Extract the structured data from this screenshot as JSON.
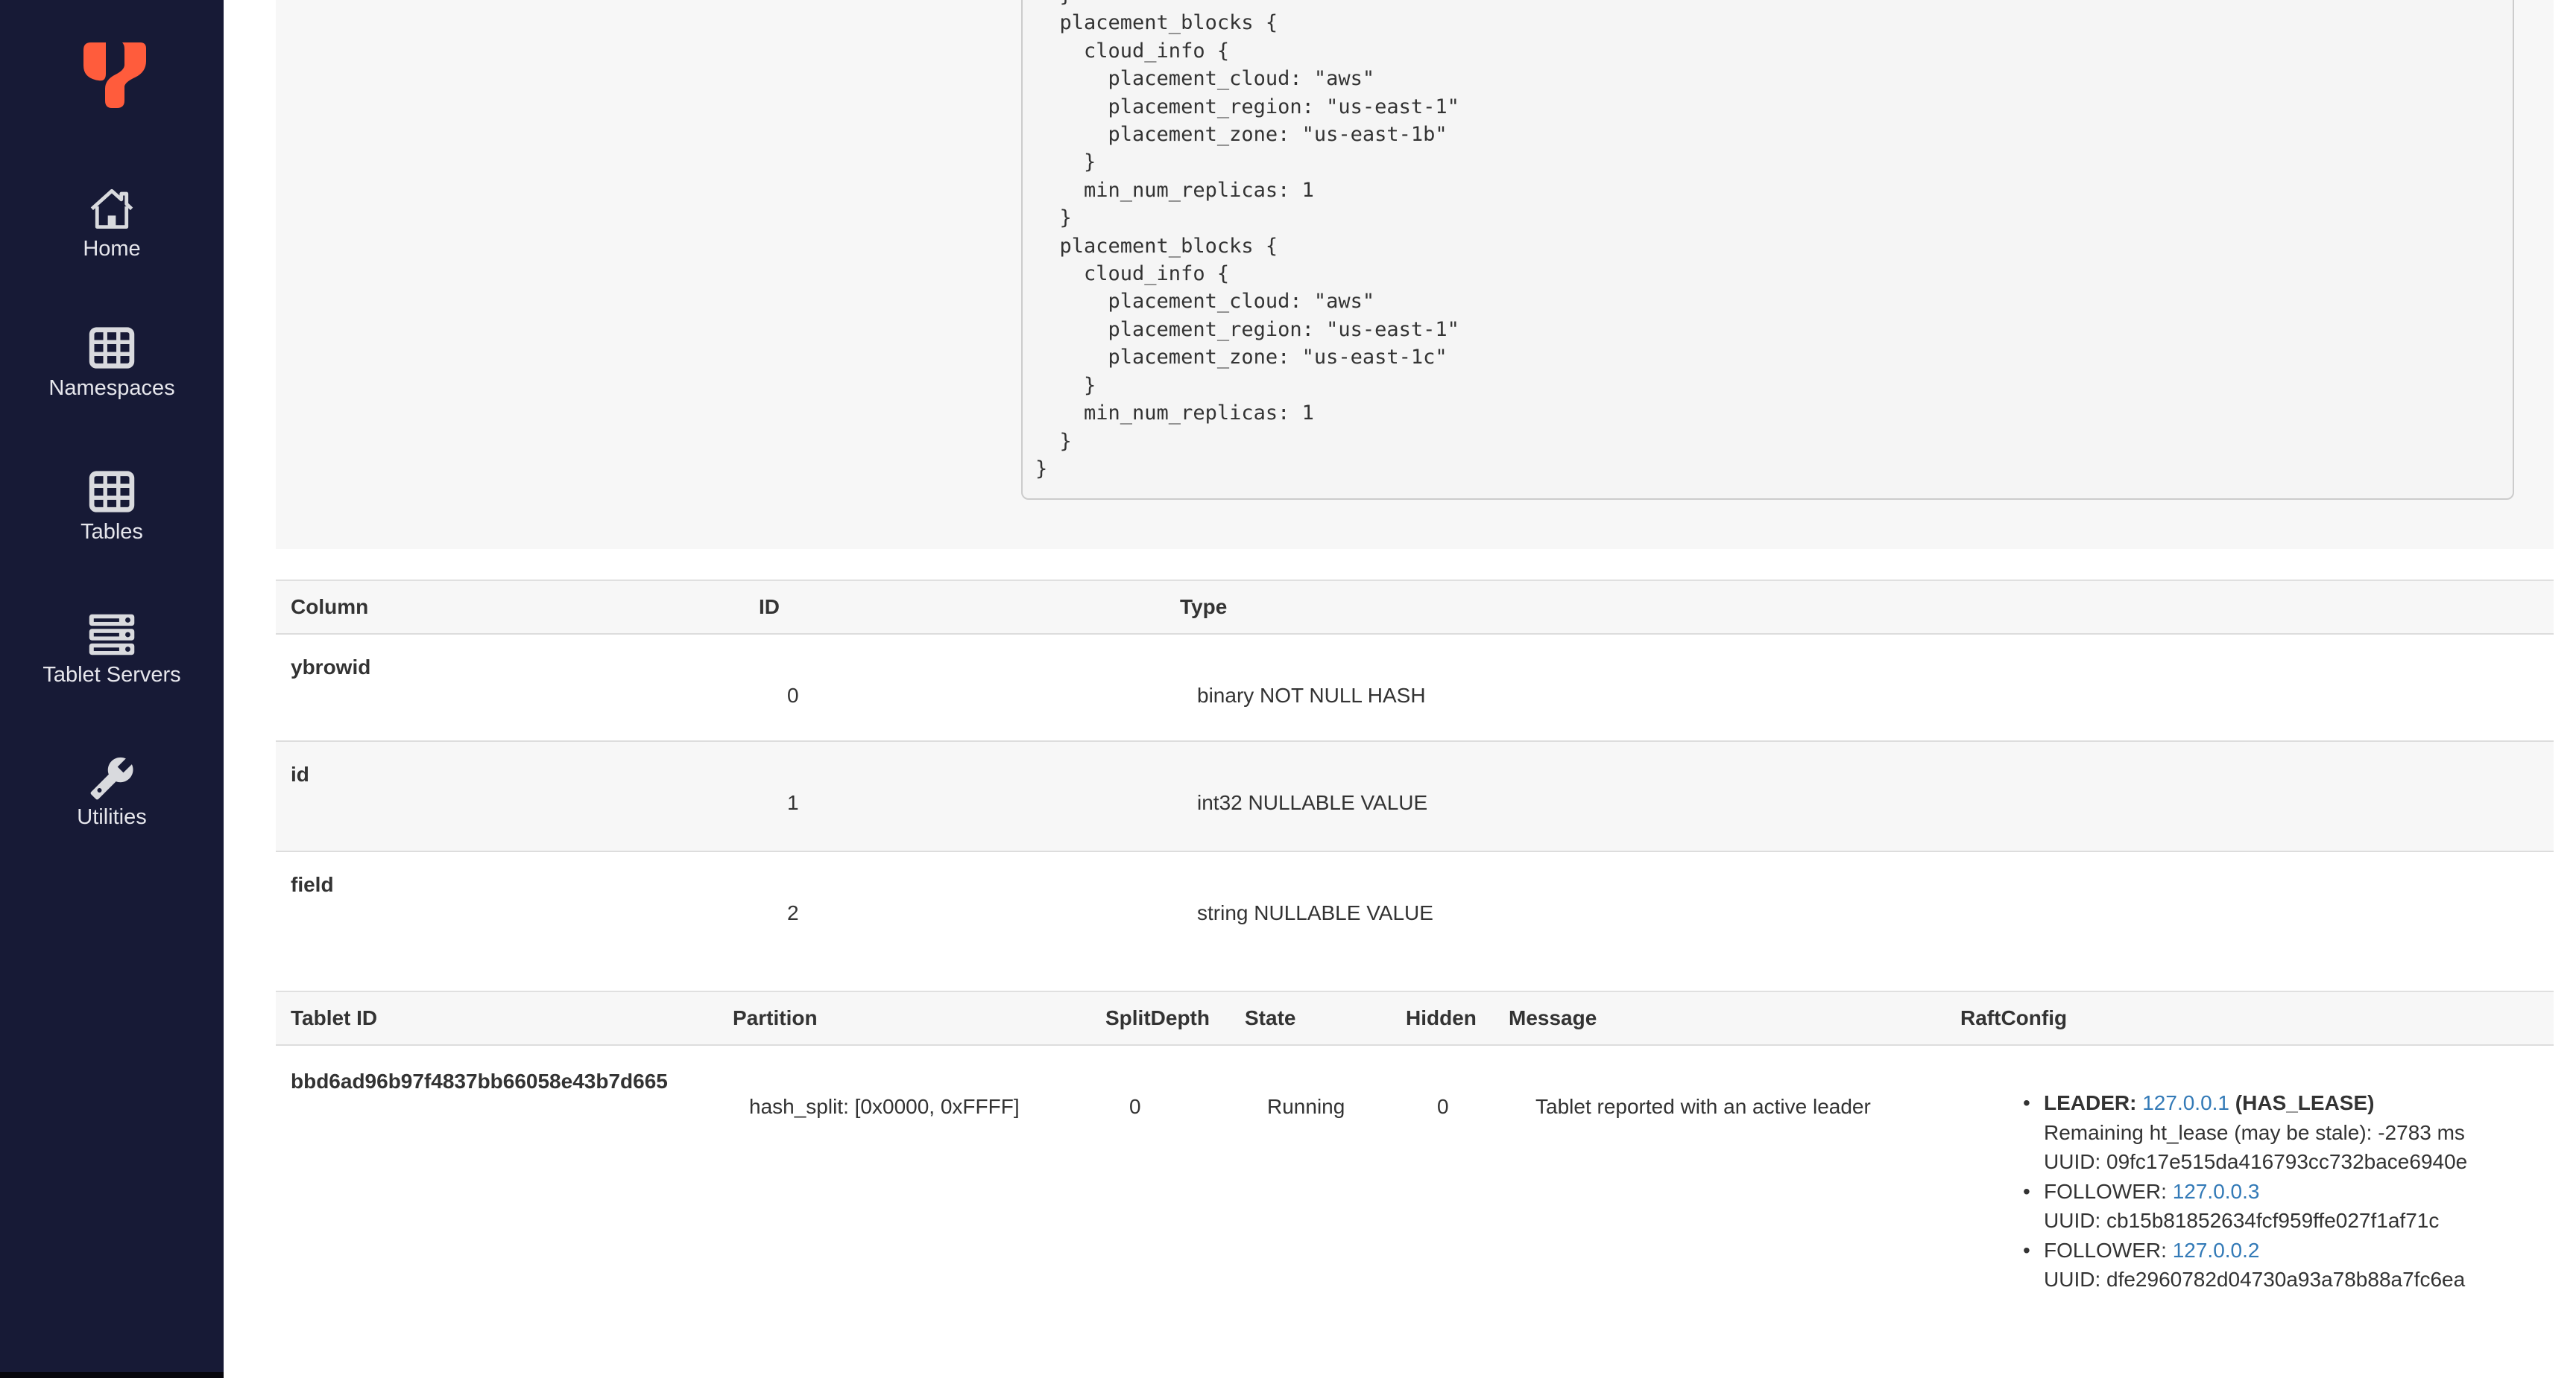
{
  "colors": {
    "sidebar_bg": "#171a36",
    "brand_orange": "#ff5c3c",
    "link_blue": "#337ab7",
    "panel_gray": "#f7f7f7",
    "code_bg": "#f5f5f5",
    "border_gray": "#dddddd"
  },
  "sidebar": {
    "logo_icon": "yugabyte-logo",
    "items": [
      {
        "label": "Home",
        "icon": "home-icon"
      },
      {
        "label": "Namespaces",
        "icon": "namespaces-grid-icon"
      },
      {
        "label": "Tables",
        "icon": "tables-grid-icon"
      },
      {
        "label": "Tablet Servers",
        "icon": "tablet-servers-icon"
      },
      {
        "label": "Utilities",
        "icon": "utilities-wrench-icon"
      }
    ]
  },
  "replication_block": {
    "code_text": "  }\n  placement_blocks {\n    cloud_info {\n      placement_cloud: \"aws\"\n      placement_region: \"us-east-1\"\n      placement_zone: \"us-east-1b\"\n    }\n    min_num_replicas: 1\n  }\n  placement_blocks {\n    cloud_info {\n      placement_cloud: \"aws\"\n      placement_region: \"us-east-1\"\n      placement_zone: \"us-east-1c\"\n    }\n    min_num_replicas: 1\n  }\n}"
  },
  "schema_table": {
    "headers": {
      "column": "Column",
      "id": "ID",
      "type": "Type"
    },
    "rows": [
      {
        "column": "ybrowid",
        "id": "0",
        "type": "binary NOT NULL HASH"
      },
      {
        "column": "id",
        "id": "1",
        "type": "int32 NULLABLE VALUE"
      },
      {
        "column": "field",
        "id": "2",
        "type": "string NULLABLE VALUE"
      }
    ]
  },
  "tablets_table": {
    "headers": {
      "tablet_id": "Tablet ID",
      "partition": "Partition",
      "split_depth": "SplitDepth",
      "state": "State",
      "hidden": "Hidden",
      "message": "Message",
      "raft_config": "RaftConfig"
    },
    "row": {
      "tablet_id": "bbd6ad96b97f4837bb66058e43b7d665",
      "partition": "hash_split: [0x0000, 0xFFFF]",
      "split_depth": "0",
      "state": "Running",
      "hidden": "0",
      "message": "Tablet reported with an active leader",
      "raft": {
        "leader": {
          "label": "LEADER:",
          "host": "127.0.0.1",
          "lease": "(HAS_LEASE)",
          "remaining": "Remaining ht_lease (may be stale): -2783 ms",
          "uuid": "UUID: 09fc17e515da416793cc732bace6940e"
        },
        "follower1": {
          "label": "FOLLOWER:",
          "host": "127.0.0.3",
          "uuid": "UUID: cb15b81852634fcf959ffe027f1af71c"
        },
        "follower2": {
          "label": "FOLLOWER:",
          "host": "127.0.0.2",
          "uuid": "UUID: dfe2960782d04730a93a78b88a7fc6ea"
        }
      }
    }
  }
}
